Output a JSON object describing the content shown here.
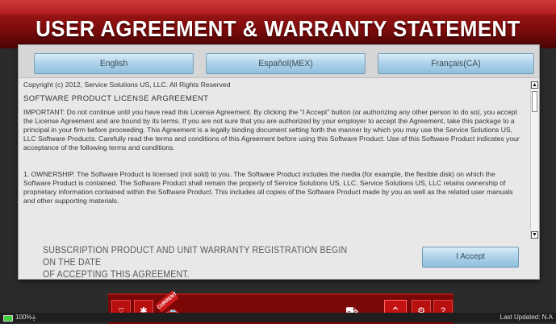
{
  "header": {
    "title": "USER AGREEMENT & WARRANTY STATEMENT"
  },
  "languages": [
    "English",
    "Español(MEX)",
    "Français(CA)"
  ],
  "agreement": {
    "copyright": "Copyright (c) 2012, Service Solutions US, LLC.  All Rights Reserved",
    "heading": "SOFTWARE PRODUCT LICENSE ARGREEMENT",
    "important": "IMPORTANT:  Do not continue until you have read this License Agreement. By clicking the \"I Accept\" button (or authorizing any other person to do so), you accept the License Agreement and are bound by its terms. If you are not sure that you are authorized by your employer to accept the Agreement, take this package to a principal in your firm before proceeding. This Agreement is a legally binding document setting forth the manner by which you may use the Service Solutions US, LLC Software Products. Carefully read the terms and conditions of this Agreement before using this Software Product. Use of this Software Product indicates your acceptance of the following terms and conditions.",
    "ownership": "1. OWNERSHIP.  The Software Product is licensed (not sold) to you. The Software Product includes the media (for example, the flexible disk) on which the Software Product is contained.  The Software Product shall remain the property of Service Solutions US, LLC. Service Solutions US, LLC retains ownership of proprietary information contained within the Software Product. This includes all copies of the Software Product made by you as well as the related user manuals and other supporting materials."
  },
  "footer": {
    "notice_line1": "SUBSCRIPTION PRODUCT AND UNIT WARRANTY REGISTRATION BEGIN ON THE DATE",
    "notice_line2": "OF ACCEPTING THIS AGREEMENT.",
    "accept_label": "I Accept"
  },
  "status": {
    "battery": "100%",
    "last_updated": "Last Updated: N.A",
    "current_tag": "CURRENT"
  },
  "icons": [
    "wifi-icon",
    "bluetooth-icon",
    "car-icon",
    "vehicle-icon",
    "chevron-up-icon",
    "gear-icon",
    "help-icon",
    "battery-icon",
    "plug-icon"
  ]
}
